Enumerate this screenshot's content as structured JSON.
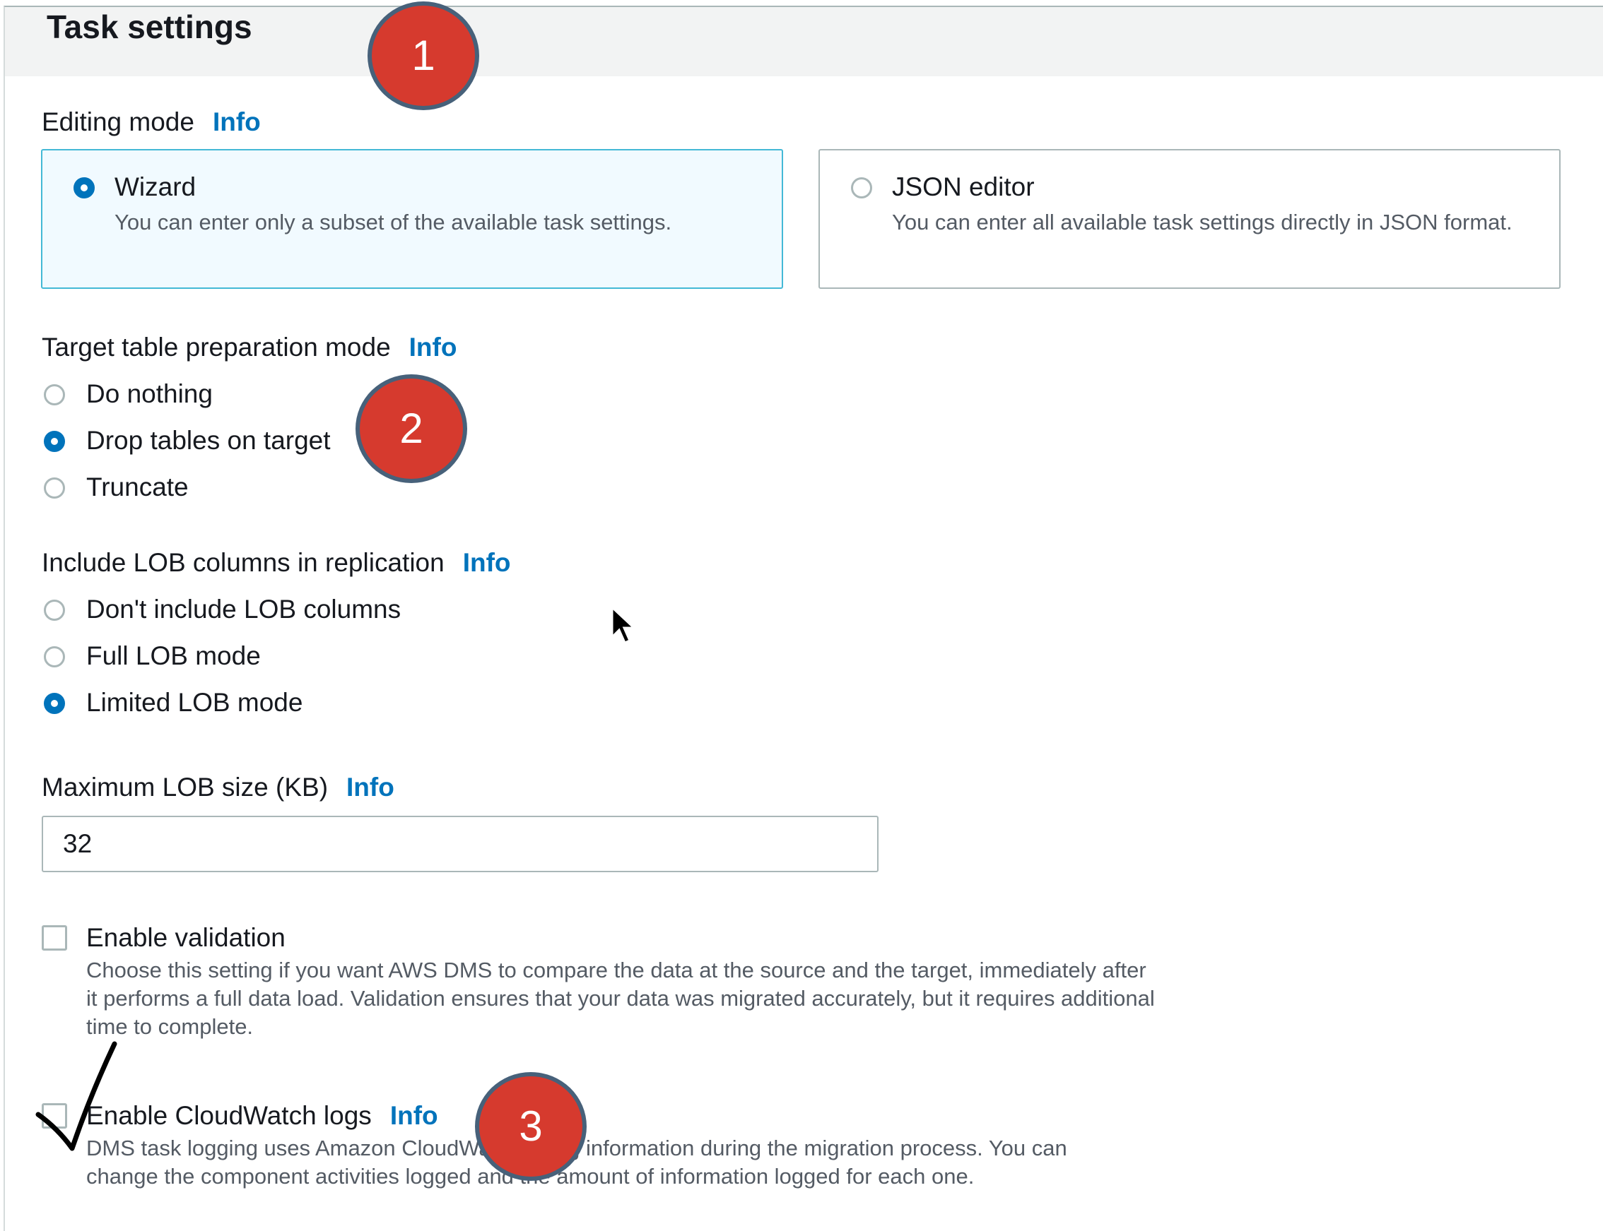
{
  "task_settings": {
    "title": "Task settings"
  },
  "editing_mode": {
    "label": "Editing mode",
    "info": "Info",
    "options": [
      {
        "title": "Wizard",
        "description": "You can enter only a subset of the available task settings.",
        "selected": true
      },
      {
        "title": "JSON editor",
        "description": "You can enter all available task settings directly in JSON format.",
        "selected": false
      }
    ]
  },
  "target_prep": {
    "label": "Target table preparation mode",
    "info": "Info",
    "options": [
      "Do nothing",
      "Drop tables on target",
      "Truncate"
    ],
    "selected": "Drop tables on target"
  },
  "lob": {
    "label": "Include LOB columns in replication",
    "info": "Info",
    "options": [
      "Don't include LOB columns",
      "Full LOB mode",
      "Limited LOB mode"
    ],
    "selected": "Limited LOB mode"
  },
  "max_lob": {
    "label": "Maximum LOB size (KB)",
    "info": "Info",
    "value": "32"
  },
  "validation": {
    "label": "Enable validation",
    "checked": false,
    "description": "Choose this setting if you want AWS DMS to compare the data at the source and the target, immediately after it performs a full data load. Validation ensures that your data was migrated accurately, but it requires additional time to complete."
  },
  "cloudwatch": {
    "label": "Enable CloudWatch logs",
    "info": "Info",
    "checked": false,
    "description": "DMS task logging uses Amazon CloudWatch to log information during the migration process. You can change the component activities logged and the amount of information logged for each one."
  },
  "annotations": {
    "markers": [
      "1",
      "2",
      "3"
    ]
  },
  "colors": {
    "accent": "#0073bb",
    "marker": "#d63a2e",
    "selected_tile_bg": "#f1faff"
  }
}
